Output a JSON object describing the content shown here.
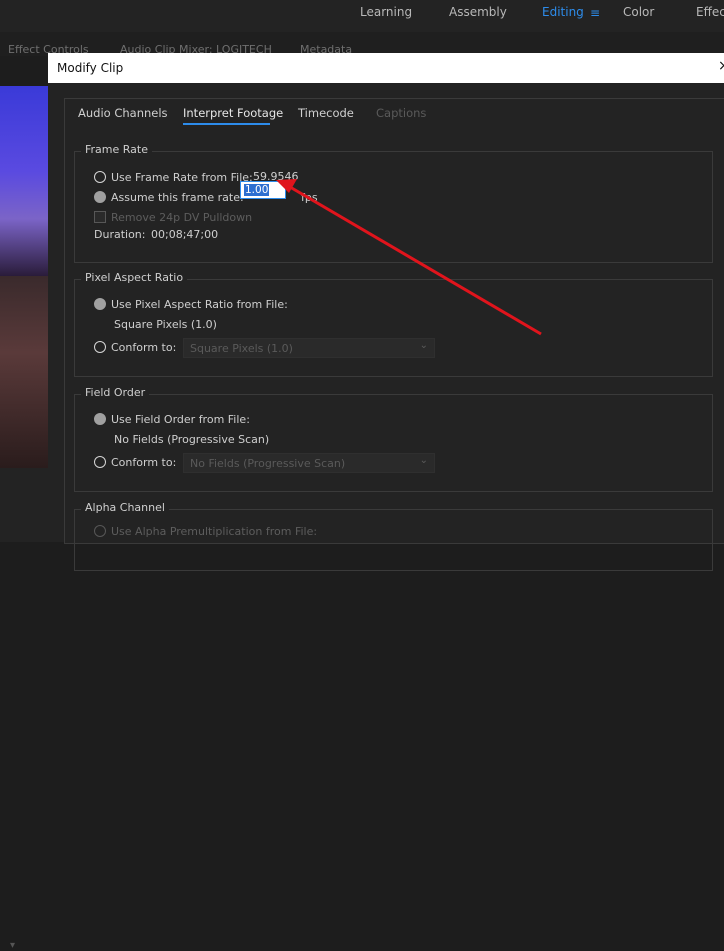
{
  "workspaces": {
    "items": [
      "Learning",
      "Assembly",
      "Editing",
      "Color",
      "Effects"
    ],
    "active": "Editing",
    "menu_glyph": "≡"
  },
  "panel_tabs": [
    "Effect Controls",
    "Audio Clip Mixer: LOGITECH",
    "Metadata"
  ],
  "dialog": {
    "title": "Modify Clip",
    "close_glyph": "×",
    "tabs": [
      "Audio Channels",
      "Interpret Footage",
      "Timecode",
      "Captions"
    ],
    "active_tab": "Interpret Footage",
    "frame_rate": {
      "title": "Frame Rate",
      "use_file_label": "Use Frame Rate from File:",
      "file_value": "59.9546",
      "assume_label": "Assume this frame rate:",
      "assume_value": "1.00",
      "fps_unit": "fps",
      "pulldown_label": "Remove 24p DV Pulldown",
      "duration_label": "Duration:",
      "duration_value": "00;08;47;00"
    },
    "pixel_aspect": {
      "title": "Pixel Aspect Ratio",
      "use_file_label": "Use Pixel Aspect Ratio from File:",
      "file_value": "Square Pixels (1.0)",
      "conform_label": "Conform to:",
      "conform_value": "Square Pixels (1.0)"
    },
    "field_order": {
      "title": "Field Order",
      "use_file_label": "Use Field Order from File:",
      "file_value": "No Fields (Progressive Scan)",
      "conform_label": "Conform to:",
      "conform_value": "No Fields (Progressive Scan)"
    },
    "alpha": {
      "title": "Alpha Channel",
      "use_file_label": "Use Alpha Premultiplication from File:"
    }
  },
  "colors": {
    "accent": "#2d8ceb",
    "annotation": "#e0141c"
  }
}
